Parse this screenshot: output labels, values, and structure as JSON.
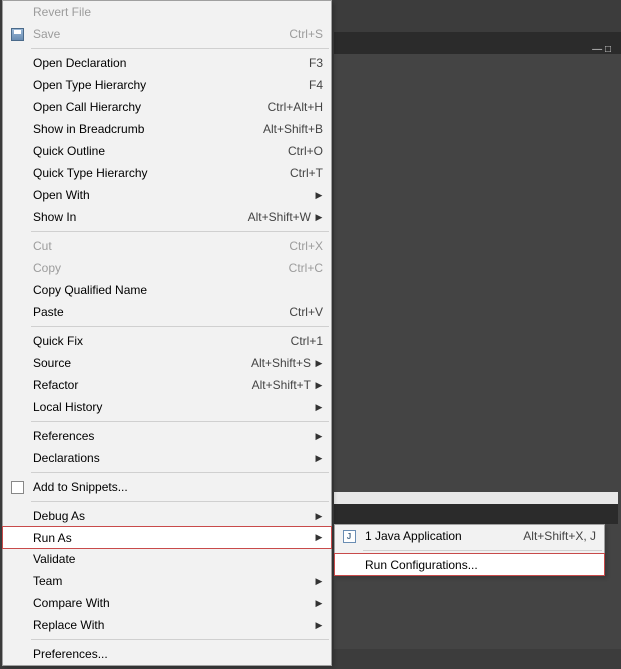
{
  "menu": {
    "revert": "Revert File",
    "save": "Save",
    "save_sc": "Ctrl+S",
    "open_decl": "Open Declaration",
    "open_decl_sc": "F3",
    "open_type_h": "Open Type Hierarchy",
    "open_type_h_sc": "F4",
    "open_call_h": "Open Call Hierarchy",
    "open_call_h_sc": "Ctrl+Alt+H",
    "show_bc": "Show in Breadcrumb",
    "show_bc_sc": "Alt+Shift+B",
    "quick_outline": "Quick Outline",
    "quick_outline_sc": "Ctrl+O",
    "quick_th": "Quick Type Hierarchy",
    "quick_th_sc": "Ctrl+T",
    "open_with": "Open With",
    "show_in": "Show In",
    "show_in_sc": "Alt+Shift+W",
    "cut": "Cut",
    "cut_sc": "Ctrl+X",
    "copy": "Copy",
    "copy_sc": "Ctrl+C",
    "copy_qn": "Copy Qualified Name",
    "paste": "Paste",
    "paste_sc": "Ctrl+V",
    "quick_fix": "Quick Fix",
    "quick_fix_sc": "Ctrl+1",
    "source": "Source",
    "source_sc": "Alt+Shift+S",
    "refactor": "Refactor",
    "refactor_sc": "Alt+Shift+T",
    "local_hist": "Local History",
    "references": "References",
    "declarations": "Declarations",
    "add_snip": "Add to Snippets...",
    "debug_as": "Debug As",
    "run_as": "Run As",
    "validate": "Validate",
    "team": "Team",
    "compare": "Compare With",
    "replace": "Replace With",
    "preferences": "Preferences..."
  },
  "submenu": {
    "java_app": "1 Java Application",
    "java_app_sc": "Alt+Shift+X, J",
    "run_config": "Run Configurations...",
    "java_letter": "J"
  }
}
